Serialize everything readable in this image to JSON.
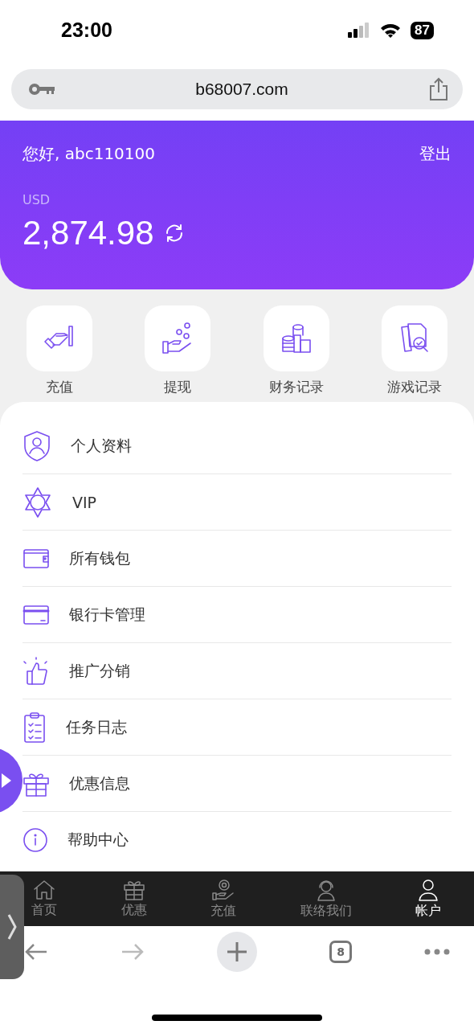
{
  "status_bar": {
    "time": "23:00",
    "battery": "87"
  },
  "address_bar": {
    "url": "b68007.com"
  },
  "account": {
    "greeting": "您好, abc110100",
    "logout": "登出",
    "currency": "USD",
    "balance": "2,874.98"
  },
  "quick_actions": [
    {
      "label": "充值",
      "kind": "deposit"
    },
    {
      "label": "提现",
      "kind": "withdraw"
    },
    {
      "label": "财务记录",
      "kind": "finance"
    },
    {
      "label": "游戏记录",
      "kind": "games"
    }
  ],
  "menu": [
    {
      "label": "个人资料",
      "kind": "profile"
    },
    {
      "label": "VIP",
      "kind": "vip"
    },
    {
      "label": "所有钱包",
      "kind": "wallet"
    },
    {
      "label": "银行卡管理",
      "kind": "card"
    },
    {
      "label": "推广分销",
      "kind": "promo"
    },
    {
      "label": "任务日志",
      "kind": "tasks"
    },
    {
      "label": "优惠信息",
      "kind": "gift"
    },
    {
      "label": "帮助中心",
      "kind": "help"
    }
  ],
  "tab_bar": [
    {
      "label": "首页",
      "kind": "home",
      "selected": false
    },
    {
      "label": "优惠",
      "kind": "gift",
      "selected": false
    },
    {
      "label": "充值",
      "kind": "deposit",
      "selected": false
    },
    {
      "label": "联络我们",
      "kind": "support",
      "selected": false
    },
    {
      "label": "帐户",
      "kind": "user",
      "selected": true
    }
  ],
  "browser_toolbar": {
    "tab_count": "8"
  }
}
